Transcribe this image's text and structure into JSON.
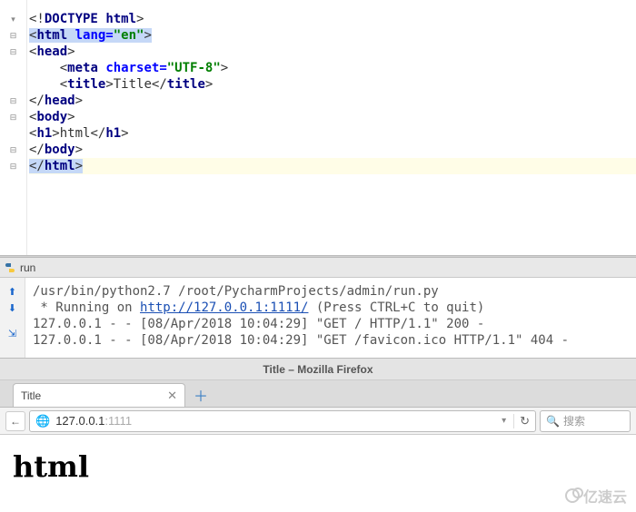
{
  "editor": {
    "lines": {
      "l1_doctype": "DOCTYPE",
      "l1_html": "html",
      "l2_tag": "html",
      "l2_attr": "lang=",
      "l2_val": "\"en\"",
      "l3_tag": "head",
      "l4_tag": "meta",
      "l4_attr": "charset=",
      "l4_val": "\"UTF-8\"",
      "l5_tag_open": "title",
      "l5_text": "Title",
      "l5_tag_close": "title",
      "l6_tag": "head",
      "l7_tag": "body",
      "l8_tag_open": "h1",
      "l8_text": "html",
      "l8_tag_close": "h1",
      "l9_tag": "body",
      "l10_tag": "html"
    }
  },
  "run_panel": {
    "label": "run"
  },
  "console": {
    "line1": "/usr/bin/python2.7 /root/PycharmProjects/admin/run.py",
    "line2_pre": " * Running on ",
    "line2_link": "http://127.0.0.1:1111/",
    "line2_post": " (Press CTRL+C to quit)",
    "line3": "127.0.0.1 - - [08/Apr/2018 10:04:29] \"GET / HTTP/1.1\" 200 -",
    "line4": "127.0.0.1 - - [08/Apr/2018 10:04:29] \"GET /favicon.ico HTTP/1.1\" 404 -"
  },
  "browser": {
    "window_title": "Title – Mozilla Firefox",
    "tab_title": "Title",
    "url_host": "127.0.0.1",
    "url_port": ":1111",
    "search_placeholder": "搜索",
    "page_h1": "html"
  },
  "watermark": "亿速云"
}
